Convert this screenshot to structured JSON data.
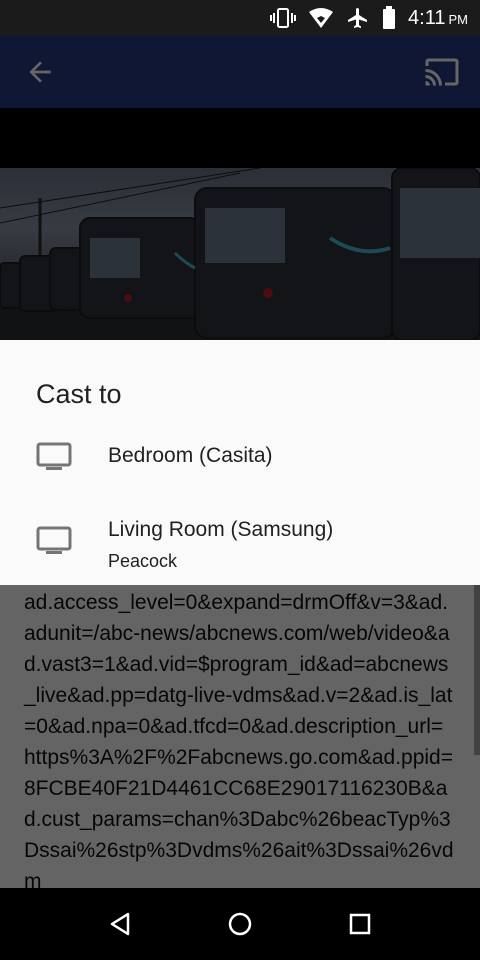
{
  "status_bar": {
    "time": "4:11",
    "ampm": "PM",
    "icons": [
      "vibrate-icon",
      "wifi-icon",
      "airplane-mode-icon",
      "battery-icon"
    ]
  },
  "app_bar": {
    "background": "#263a82",
    "icons": [
      "back-arrow-icon",
      "cast-icon"
    ]
  },
  "video": {
    "description_icon": "video-thumbnail"
  },
  "cast_dialog": {
    "title": "Cast to",
    "devices": [
      {
        "name": "Bedroom (Casita)",
        "subtitle": ""
      },
      {
        "name": "Living Room (Samsung)",
        "subtitle": "Peacock"
      }
    ]
  },
  "article": {
    "text": "ad.access_level=0&expand=drmOff&v=3&ad.adunit=/abc-news/abcnews.com/web/video&ad.vast3=1&ad.vid=$program_id&ad=abcnews_live&ad.pp=datg-live-vdms&ad.v=2&ad.is_lat=0&ad.npa=0&ad.tfcd=0&ad.description_url=https%3A%2F%2Fabcnews.go.com&ad.ppid=8FCBE40F21D4461CC68E29017116230B&ad.cust_params=chan%3Dabc%26beacTyp%3Dssai%26stp%3Dvdms%26ait%3Dssai%26vdm"
  },
  "nav_bar": {
    "icons": [
      "back-triangle-icon",
      "home-circle-icon",
      "recents-square-icon"
    ]
  }
}
